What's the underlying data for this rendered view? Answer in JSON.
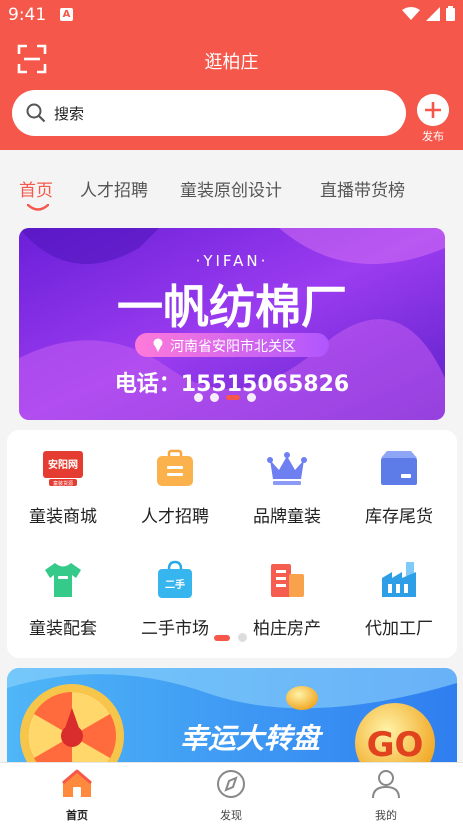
{
  "status": {
    "time": "9:41",
    "app_badge": "A"
  },
  "header": {
    "title": "逛柏庄",
    "search_placeholder": "搜索",
    "publish_label": "发布"
  },
  "tabs": [
    {
      "label": "首页",
      "active": true
    },
    {
      "label": "人才招聘",
      "active": false
    },
    {
      "label": "童装原创设计",
      "active": false
    },
    {
      "label": "直播带货榜",
      "active": false
    }
  ],
  "banner": {
    "brand": "·YIFAN·",
    "headline": "一帆纺棉厂",
    "address": "河南省安阳市北关区",
    "phone": "电话：15515065826",
    "page_count": 4,
    "active_page": 2
  },
  "grid": {
    "items": [
      {
        "label": "童装商城",
        "icon": "anyang-logo-icon",
        "badge_top": "安阳网",
        "badge_bottom": "童装货源"
      },
      {
        "label": "人才招聘",
        "icon": "briefcase-icon"
      },
      {
        "label": "品牌童装",
        "icon": "crown-icon"
      },
      {
        "label": "库存尾货",
        "icon": "box-icon"
      },
      {
        "label": "童装配套",
        "icon": "tshirt-icon"
      },
      {
        "label": "二手市场",
        "icon": "shopping-bag-icon",
        "badge": "二手"
      },
      {
        "label": "柏庄房产",
        "icon": "building-icon"
      },
      {
        "label": "代加工厂",
        "icon": "factory-icon"
      }
    ],
    "page_count": 2,
    "active_page": 0
  },
  "promo": {
    "title": "幸运大转盘",
    "button": "GO"
  },
  "bottom_nav": [
    {
      "label": "首页",
      "icon": "home-icon",
      "active": true
    },
    {
      "label": "发现",
      "icon": "compass-icon",
      "active": false
    },
    {
      "label": "我的",
      "icon": "profile-icon",
      "active": false
    }
  ],
  "colors": {
    "primary": "#f5574a",
    "banner_purple": "#7b2fe0"
  }
}
